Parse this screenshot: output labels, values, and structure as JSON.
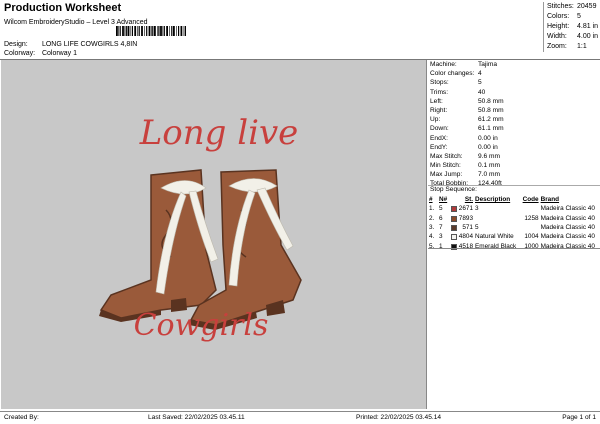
{
  "header": {
    "title": "Production Worksheet",
    "subtitle": "Wilcom EmbroideryStudio – Level 3 Advanced",
    "design_label": "Design:",
    "design_value": "LONG LIFE COWGIRLS 4,8IN",
    "colorway_label": "Colorway:",
    "colorway_value": "Colorway 1"
  },
  "stats": [
    {
      "k": "Stitches:",
      "v": "20459"
    },
    {
      "k": "Colors:",
      "v": "5"
    },
    {
      "k": "Height:",
      "v": "4.81 in"
    },
    {
      "k": "Width:",
      "v": "4.00 in"
    },
    {
      "k": "Zoom:",
      "v": "1:1"
    }
  ],
  "design": {
    "text_top": "Long live",
    "text_bottom": "Cowgirls",
    "text_color": "#c8403d",
    "boot_color": "#9a5a3a",
    "boot_dark": "#5a3320",
    "ribbon_color": "#f2f0e8"
  },
  "info": [
    {
      "k": "Machine:",
      "v": "Tajima"
    },
    {
      "k": "Color changes:",
      "v": "4"
    },
    {
      "k": "Stops:",
      "v": "5"
    },
    {
      "k": "Trims:",
      "v": "40"
    },
    {
      "k": "Left:",
      "v": "50.8 mm"
    },
    {
      "k": "Right:",
      "v": "50.8 mm"
    },
    {
      "k": "Up:",
      "v": "61.2 mm"
    },
    {
      "k": "Down:",
      "v": "61.1 mm"
    },
    {
      "k": "EndX:",
      "v": "0.00 in"
    },
    {
      "k": "EndY:",
      "v": "0.00 in"
    },
    {
      "k": "Max Stitch:",
      "v": "9.6 mm"
    },
    {
      "k": "Min Stitch:",
      "v": "0.1 mm"
    },
    {
      "k": "Max Jump:",
      "v": "7.0 mm"
    },
    {
      "k": "Total Bobbin:",
      "v": "124.40ft"
    }
  ],
  "sequence": {
    "title": "Stop Sequence:",
    "headers": {
      "num": "#",
      "n": "N#",
      "st": "St.",
      "desc": "Description",
      "code": "Code",
      "brand": "Brand"
    },
    "rows": [
      {
        "num": "1.",
        "n": "5",
        "color": "#b03a3a",
        "st": "2671",
        "desc": "3",
        "code": "",
        "brand": "Madeira Classic 40"
      },
      {
        "num": "2.",
        "n": "6",
        "color": "#8a4a2a",
        "st": "7893",
        "desc": "",
        "code": "1258",
        "brand": "Madeira Classic 40"
      },
      {
        "num": "3.",
        "n": "7",
        "color": "#5a3a2a",
        "st": "571",
        "desc": "5",
        "code": "",
        "brand": "Madeira Classic 40"
      },
      {
        "num": "4.",
        "n": "3",
        "color": "#f4f4f0",
        "st": "4804",
        "desc": "Natural White",
        "code": "1004",
        "brand": "Madeira Classic 40"
      },
      {
        "num": "5.",
        "n": "1",
        "color": "#111111",
        "st": "4518",
        "desc": "Emerald Black",
        "code": "1000",
        "brand": "Madeira Classic 40"
      }
    ]
  },
  "footer": {
    "created": "Created By:",
    "last_saved": "Last Saved: 22/02/2025 03.45.11",
    "printed": "Printed: 22/02/2025 03.45.14",
    "page": "Page 1 of 1"
  }
}
